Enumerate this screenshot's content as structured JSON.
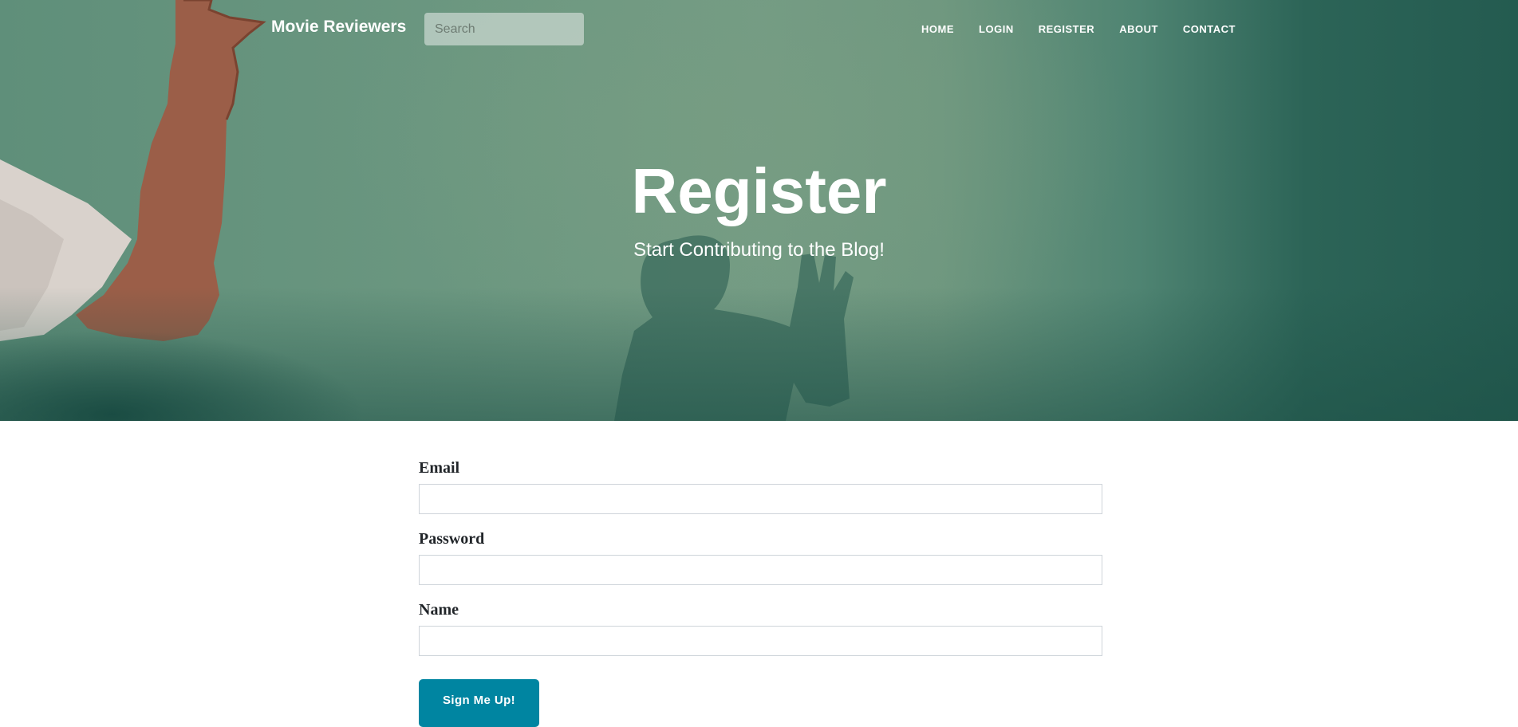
{
  "navbar": {
    "brand": "Movie Reviewers",
    "search_placeholder": "Search",
    "links": [
      "HOME",
      "LOGIN",
      "REGISTER",
      "ABOUT",
      "CONTACT"
    ]
  },
  "hero": {
    "heading": "Register",
    "subheading": "Start Contributing to the Blog!"
  },
  "form": {
    "email_label": "Email",
    "email_value": "",
    "password_label": "Password",
    "password_value": "",
    "name_label": "Name",
    "name_value": "",
    "submit_label": "Sign Me Up!"
  },
  "colors": {
    "hero_green": "#6d9881",
    "hero_dark_teal": "#245b50",
    "button": "#0085a1",
    "label_text": "#212529",
    "input_border": "#ced4da"
  }
}
